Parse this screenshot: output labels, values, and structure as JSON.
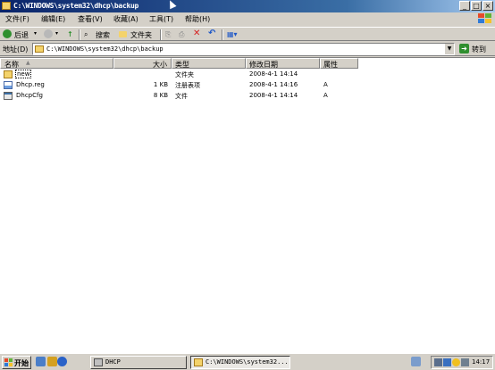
{
  "window": {
    "title": "C:\\WINDOWS\\system32\\dhcp\\backup",
    "min_glyph": "_",
    "max_glyph": "□",
    "close_glyph": "×"
  },
  "menu": [
    {
      "label": "文件(F)"
    },
    {
      "label": "编辑(E)"
    },
    {
      "label": "查看(V)"
    },
    {
      "label": "收藏(A)"
    },
    {
      "label": "工具(T)"
    },
    {
      "label": "帮助(H)"
    }
  ],
  "toolbar": {
    "back_label": "后退",
    "search_label": "搜索",
    "folders_label": "文件夹"
  },
  "address": {
    "label": "地址(D)",
    "value": "C:\\WINDOWS\\system32\\dhcp\\backup",
    "go_label": "转到"
  },
  "columns": {
    "name": "名称",
    "size": "大小",
    "type": "类型",
    "modified": "修改日期",
    "attributes": "属性"
  },
  "files": [
    {
      "name": "new",
      "size": "",
      "type": "文件夹",
      "modified": "2008-4-1 14:14",
      "attributes": "",
      "icon": "folder-icon"
    },
    {
      "name": "Dhcp.reg",
      "size": "1 KB",
      "type": "注册表项",
      "modified": "2008-4-1 14:16",
      "attributes": "A",
      "icon": "registry-icon"
    },
    {
      "name": "DhcpCfg",
      "size": "8 KB",
      "type": "文件",
      "modified": "2008-4-1 14:14",
      "attributes": "A",
      "icon": "file-icon"
    }
  ],
  "taskbar": {
    "start_label": "开始",
    "tasks": [
      {
        "label": "DHCP",
        "active": false
      },
      {
        "label": "C:\\WINDOWS\\system32...",
        "active": true
      }
    ],
    "clock": "14:17"
  },
  "colors": {
    "title_active": "#0a246a",
    "face": "#d4d0c8",
    "folder": "#f4d36b",
    "go_green": "#2f8f2f"
  }
}
